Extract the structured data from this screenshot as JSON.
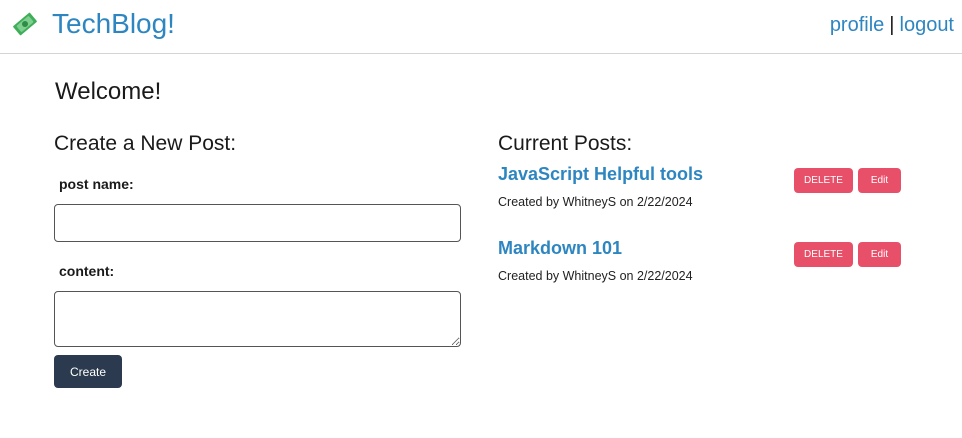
{
  "nav": {
    "brand": "TechBlog!",
    "logo_icon": "money-stack-icon",
    "profile_label": "profile",
    "separator": "|",
    "logout_label": "logout"
  },
  "main": {
    "welcome": "Welcome!",
    "create": {
      "title": "Create a New Post:",
      "post_name_label": "post name:",
      "post_name_value": "",
      "content_label": "content:",
      "content_value": "",
      "button_label": "Create"
    },
    "current": {
      "title": "Current Posts:",
      "delete_label": "DELETE",
      "edit_label": "Edit",
      "posts": [
        {
          "title": "JavaScript Helpful tools",
          "meta": "Created by WhitneyS on 2/22/2024"
        },
        {
          "title": "Markdown 101",
          "meta": "Created by WhitneyS on 2/22/2024"
        }
      ]
    }
  },
  "colors": {
    "brand": "#2e86c1",
    "danger": "#e8506a",
    "dark_button": "#2b3a4e"
  }
}
